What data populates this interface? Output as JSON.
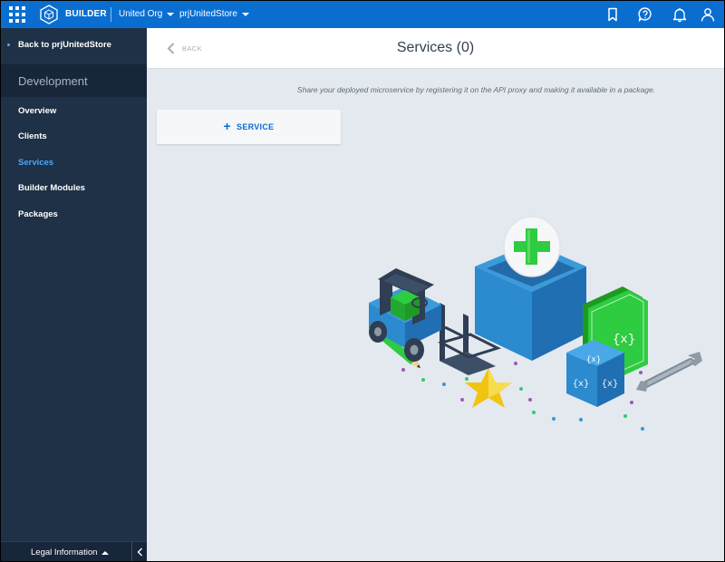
{
  "topbar": {
    "app_name": "BUILDER",
    "org": "United Org",
    "project": "prjUnitedStore",
    "icons": [
      "app-grid-icon",
      "builder-logo-icon",
      "bookmark-icon",
      "help-icon",
      "bell-icon",
      "user-icon"
    ]
  },
  "sidebar": {
    "back_label": "Back to prjUnitedStore",
    "section": "Development",
    "items": [
      {
        "label": "Overview",
        "active": false
      },
      {
        "label": "Clients",
        "active": false
      },
      {
        "label": "Services",
        "active": true
      },
      {
        "label": "Builder Modules",
        "active": false
      },
      {
        "label": "Packages",
        "active": false
      }
    ],
    "footer": {
      "legal": "Legal Information"
    }
  },
  "main": {
    "back_label": "BACK",
    "title": "Services (0)",
    "subtitle": "Share your deployed microservice by registering it on the API proxy and making it available in a package.",
    "add_service_label": "SERVICE",
    "illustration": "empty-services-illustration"
  },
  "colors": {
    "brand": "#0a6ed1",
    "sidebar": "#1f3146",
    "active_nav": "#47a8ff",
    "background": "#e4e9ef"
  }
}
